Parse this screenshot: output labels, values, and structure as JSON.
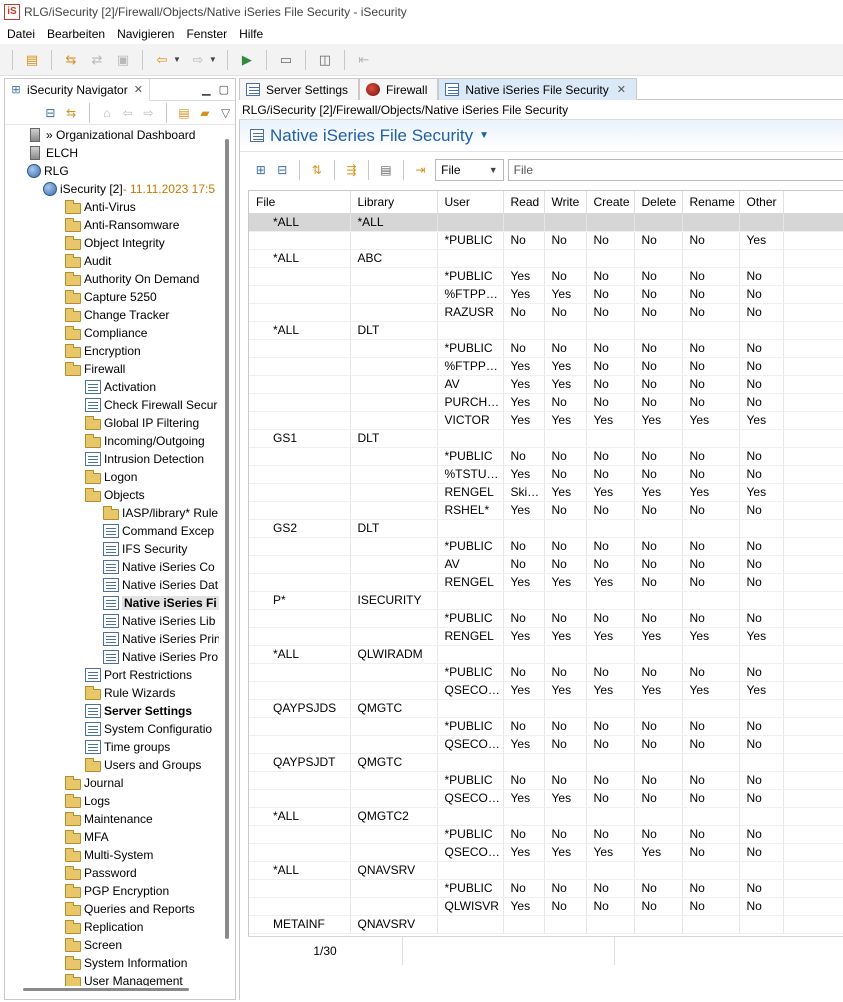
{
  "window": {
    "app_icon": "iS",
    "title": "RLG/iSecurity [2]/Firewall/Objects/Native iSeries File Security - iSecurity"
  },
  "menu": [
    "Datei",
    "Bearbeiten",
    "Navigieren",
    "Fenster",
    "Hilfe"
  ],
  "navigator": {
    "tab_label": "iSecurity Navigator",
    "tree": [
      {
        "label": "» Organizational Dashboard",
        "icon": "server-icon",
        "level": 0
      },
      {
        "label": "ELCH",
        "icon": "server-icon",
        "level": 0
      },
      {
        "label": "RLG",
        "icon": "globe-icon",
        "level": 0
      },
      {
        "label": "iSecurity [2]",
        "date": " - 11.11.2023 17:5",
        "icon": "globe-icon",
        "level": 1
      },
      {
        "label": "Anti-Virus",
        "icon": "folder-icon",
        "level": 2
      },
      {
        "label": "Anti-Ransomware",
        "icon": "folder-icon",
        "level": 2
      },
      {
        "label": "Object Integrity",
        "icon": "folder-icon",
        "level": 2
      },
      {
        "label": "Audit",
        "icon": "folder-icon",
        "level": 2
      },
      {
        "label": "Authority On Demand",
        "icon": "folder-icon",
        "level": 2
      },
      {
        "label": "Capture 5250",
        "icon": "folder-icon",
        "level": 2
      },
      {
        "label": "Change Tracker",
        "icon": "folder-icon",
        "level": 2
      },
      {
        "label": "Compliance",
        "icon": "folder-icon",
        "level": 2
      },
      {
        "label": "Encryption",
        "icon": "folder-icon",
        "level": 2
      },
      {
        "label": "Firewall",
        "icon": "folder-icon",
        "level": 2
      },
      {
        "label": "Activation",
        "icon": "document-icon",
        "level": 3
      },
      {
        "label": "Check Firewall Secur",
        "icon": "document-icon",
        "level": 3
      },
      {
        "label": "Global IP Filtering",
        "icon": "folder-icon",
        "level": 3
      },
      {
        "label": "Incoming/Outgoing",
        "icon": "folder-icon",
        "level": 3
      },
      {
        "label": "Intrusion Detection",
        "icon": "document-icon",
        "level": 3
      },
      {
        "label": "Logon",
        "icon": "folder-icon",
        "level": 3
      },
      {
        "label": "Objects",
        "icon": "folder-icon",
        "level": 3
      },
      {
        "label": "IASP/library* Rule",
        "icon": "folder-icon",
        "level": 4
      },
      {
        "label": "Command Excep",
        "icon": "document-icon",
        "level": 4
      },
      {
        "label": "IFS Security",
        "icon": "document-icon",
        "level": 4
      },
      {
        "label": "Native iSeries Co",
        "icon": "document-icon",
        "level": 4
      },
      {
        "label": "Native iSeries Dat",
        "icon": "document-icon",
        "level": 4
      },
      {
        "label": "Native iSeries Fi",
        "icon": "document-icon",
        "level": 4,
        "selected": true
      },
      {
        "label": "Native iSeries Lib",
        "icon": "document-icon",
        "level": 4
      },
      {
        "label": "Native iSeries Prin",
        "icon": "document-icon",
        "level": 4
      },
      {
        "label": "Native iSeries Pro",
        "icon": "document-icon",
        "level": 4
      },
      {
        "label": "Port Restrictions",
        "icon": "document-icon",
        "level": 3
      },
      {
        "label": "Rule Wizards",
        "icon": "folder-icon",
        "level": 3
      },
      {
        "label": "Server Settings",
        "icon": "document-icon",
        "level": 3,
        "bold": true
      },
      {
        "label": "System Configuratio",
        "icon": "document-icon",
        "level": 3
      },
      {
        "label": "Time groups",
        "icon": "document-icon",
        "level": 3
      },
      {
        "label": "Users and Groups",
        "icon": "folder-icon",
        "level": 3
      },
      {
        "label": "Journal",
        "icon": "folder-icon",
        "level": 2
      },
      {
        "label": "Logs",
        "icon": "folder-icon",
        "level": 2
      },
      {
        "label": "Maintenance",
        "icon": "folder-icon",
        "level": 2
      },
      {
        "label": "MFA",
        "icon": "folder-icon",
        "level": 2
      },
      {
        "label": "Multi-System",
        "icon": "folder-icon",
        "level": 2
      },
      {
        "label": "Password",
        "icon": "folder-icon",
        "level": 2
      },
      {
        "label": "PGP Encryption",
        "icon": "folder-icon",
        "level": 2
      },
      {
        "label": "Queries and Reports",
        "icon": "folder-icon",
        "level": 2
      },
      {
        "label": "Replication",
        "icon": "folder-icon",
        "level": 2
      },
      {
        "label": "Screen",
        "icon": "folder-icon",
        "level": 2
      },
      {
        "label": "System Information",
        "icon": "folder-icon",
        "level": 2
      },
      {
        "label": "User Management",
        "icon": "folder-icon",
        "level": 2
      }
    ]
  },
  "editor_tabs": [
    {
      "label": "Server Settings",
      "icon": "document-icon",
      "active": false
    },
    {
      "label": "Firewall",
      "icon": "firewall-icon",
      "active": false
    },
    {
      "label": "Native iSeries File Security",
      "icon": "document-icon",
      "active": true,
      "closable": true
    }
  ],
  "breadcrumb": "RLG/iSecurity [2]/Firewall/Objects/Native iSeries File Security",
  "editor": {
    "title": "Native iSeries File Security",
    "filter_select": "File",
    "filter_placeholder": "File"
  },
  "table": {
    "columns": [
      "File",
      "Library",
      "User",
      "Read",
      "Write",
      "Create",
      "Delete",
      "Rename",
      "Other"
    ],
    "rows": [
      {
        "file": "*ALL",
        "library": "*ALL",
        "selected": true
      },
      {
        "user": "*PUBLIC",
        "v": [
          "No",
          "No",
          "No",
          "No",
          "No",
          "Yes"
        ]
      },
      {
        "file": "*ALL",
        "library": "ABC"
      },
      {
        "user": "*PUBLIC",
        "v": [
          "Yes",
          "No",
          "No",
          "No",
          "No",
          "No"
        ]
      },
      {
        "user": "%FTPPU...",
        "v": [
          "Yes",
          "Yes",
          "No",
          "No",
          "No",
          "No"
        ]
      },
      {
        "user": "RAZUSR",
        "v": [
          "No",
          "No",
          "No",
          "No",
          "No",
          "No"
        ]
      },
      {
        "file": "*ALL",
        "library": "DLT"
      },
      {
        "user": "*PUBLIC",
        "v": [
          "No",
          "No",
          "No",
          "No",
          "No",
          "No"
        ]
      },
      {
        "user": "%FTPPU...",
        "v": [
          "Yes",
          "Yes",
          "No",
          "No",
          "No",
          "No"
        ]
      },
      {
        "user": "AV",
        "v": [
          "Yes",
          "Yes",
          "No",
          "No",
          "No",
          "No"
        ]
      },
      {
        "user": "PURCHA...",
        "v": [
          "Yes",
          "No",
          "No",
          "No",
          "No",
          "No"
        ]
      },
      {
        "user": "VICTOR",
        "v": [
          "Yes",
          "Yes",
          "Yes",
          "Yes",
          "Yes",
          "Yes"
        ]
      },
      {
        "file": "GS1",
        "library": "DLT"
      },
      {
        "user": "*PUBLIC",
        "v": [
          "No",
          "No",
          "No",
          "No",
          "No",
          "No"
        ]
      },
      {
        "user": "%TSTUSR",
        "v": [
          "Yes",
          "No",
          "No",
          "No",
          "No",
          "No"
        ]
      },
      {
        "user": "RENGEL",
        "v": [
          "Skip...",
          "Yes",
          "Yes",
          "Yes",
          "Yes",
          "Yes"
        ]
      },
      {
        "user": "RSHEL*",
        "v": [
          "Yes",
          "No",
          "No",
          "No",
          "No",
          "No"
        ]
      },
      {
        "file": "GS2",
        "library": "DLT"
      },
      {
        "user": "*PUBLIC",
        "v": [
          "No",
          "No",
          "No",
          "No",
          "No",
          "No"
        ]
      },
      {
        "user": "AV",
        "v": [
          "No",
          "No",
          "No",
          "No",
          "No",
          "No"
        ]
      },
      {
        "user": "RENGEL",
        "v": [
          "Yes",
          "Yes",
          "Yes",
          "No",
          "No",
          "No"
        ]
      },
      {
        "file": "P*",
        "library": "ISECURITY"
      },
      {
        "user": "*PUBLIC",
        "v": [
          "No",
          "No",
          "No",
          "No",
          "No",
          "No"
        ]
      },
      {
        "user": "RENGEL",
        "v": [
          "Yes",
          "Yes",
          "Yes",
          "Yes",
          "Yes",
          "Yes"
        ]
      },
      {
        "file": "*ALL",
        "library": "QLWIRADM"
      },
      {
        "user": "*PUBLIC",
        "v": [
          "No",
          "No",
          "No",
          "No",
          "No",
          "No"
        ]
      },
      {
        "user": "QSECOFR",
        "v": [
          "Yes",
          "Yes",
          "Yes",
          "Yes",
          "Yes",
          "Yes"
        ]
      },
      {
        "file": "QAYPSJDS",
        "library": "QMGTC"
      },
      {
        "user": "*PUBLIC",
        "v": [
          "No",
          "No",
          "No",
          "No",
          "No",
          "No"
        ]
      },
      {
        "user": "QSECOFR",
        "v": [
          "Yes",
          "No",
          "No",
          "No",
          "No",
          "No"
        ]
      },
      {
        "file": "QAYPSJDT",
        "library": "QMGTC"
      },
      {
        "user": "*PUBLIC",
        "v": [
          "No",
          "No",
          "No",
          "No",
          "No",
          "No"
        ]
      },
      {
        "user": "QSECOFR",
        "v": [
          "Yes",
          "Yes",
          "No",
          "No",
          "No",
          "No"
        ]
      },
      {
        "file": "*ALL",
        "library": "QMGTC2"
      },
      {
        "user": "*PUBLIC",
        "v": [
          "No",
          "No",
          "No",
          "No",
          "No",
          "No"
        ]
      },
      {
        "user": "QSECOFR",
        "v": [
          "Yes",
          "Yes",
          "Yes",
          "Yes",
          "No",
          "No"
        ]
      },
      {
        "file": "*ALL",
        "library": "QNAVSRV"
      },
      {
        "user": "*PUBLIC",
        "v": [
          "No",
          "No",
          "No",
          "No",
          "No",
          "No"
        ]
      },
      {
        "user": "QLWISVR",
        "v": [
          "Yes",
          "No",
          "No",
          "No",
          "No",
          "No"
        ]
      },
      {
        "file": "METAINF",
        "library": "QNAVSRV"
      }
    ],
    "pager": "1/30"
  }
}
